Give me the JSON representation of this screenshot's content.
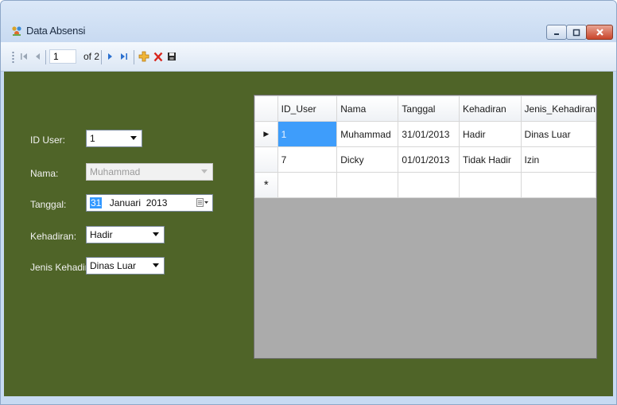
{
  "window": {
    "title": "Data Absensi"
  },
  "navigator": {
    "position": "1",
    "count_label": "of 2"
  },
  "form": {
    "id_user": {
      "label": "ID User:",
      "value": "1"
    },
    "nama": {
      "label": "Nama:",
      "value": "Muhammad"
    },
    "tanggal": {
      "label": "Tanggal:",
      "day": "31",
      "month_year": "Januari  2013"
    },
    "kehadiran": {
      "label": "Kehadiran:",
      "value": "Hadir"
    },
    "jenis_kehadiran": {
      "label": "Jenis Kehadiran:",
      "value": "Dinas Luar"
    }
  },
  "grid": {
    "columns": [
      "ID_User",
      "Nama",
      "Tanggal",
      "Kehadiran",
      "Jenis_Kehadiran"
    ],
    "rows": [
      [
        "1",
        "Muhammad",
        "31/01/2013",
        "Hadir",
        "Dinas Luar"
      ],
      [
        "7",
        "Dicky",
        "01/01/2013",
        "Tidak Hadir",
        "Izin"
      ]
    ],
    "new_row_marker": "*",
    "current_row_marker": "▶"
  },
  "colors": {
    "form_background": "#4f6428",
    "grid_empty_area": "#ababab",
    "selected_cell": "#3e9dfb"
  }
}
